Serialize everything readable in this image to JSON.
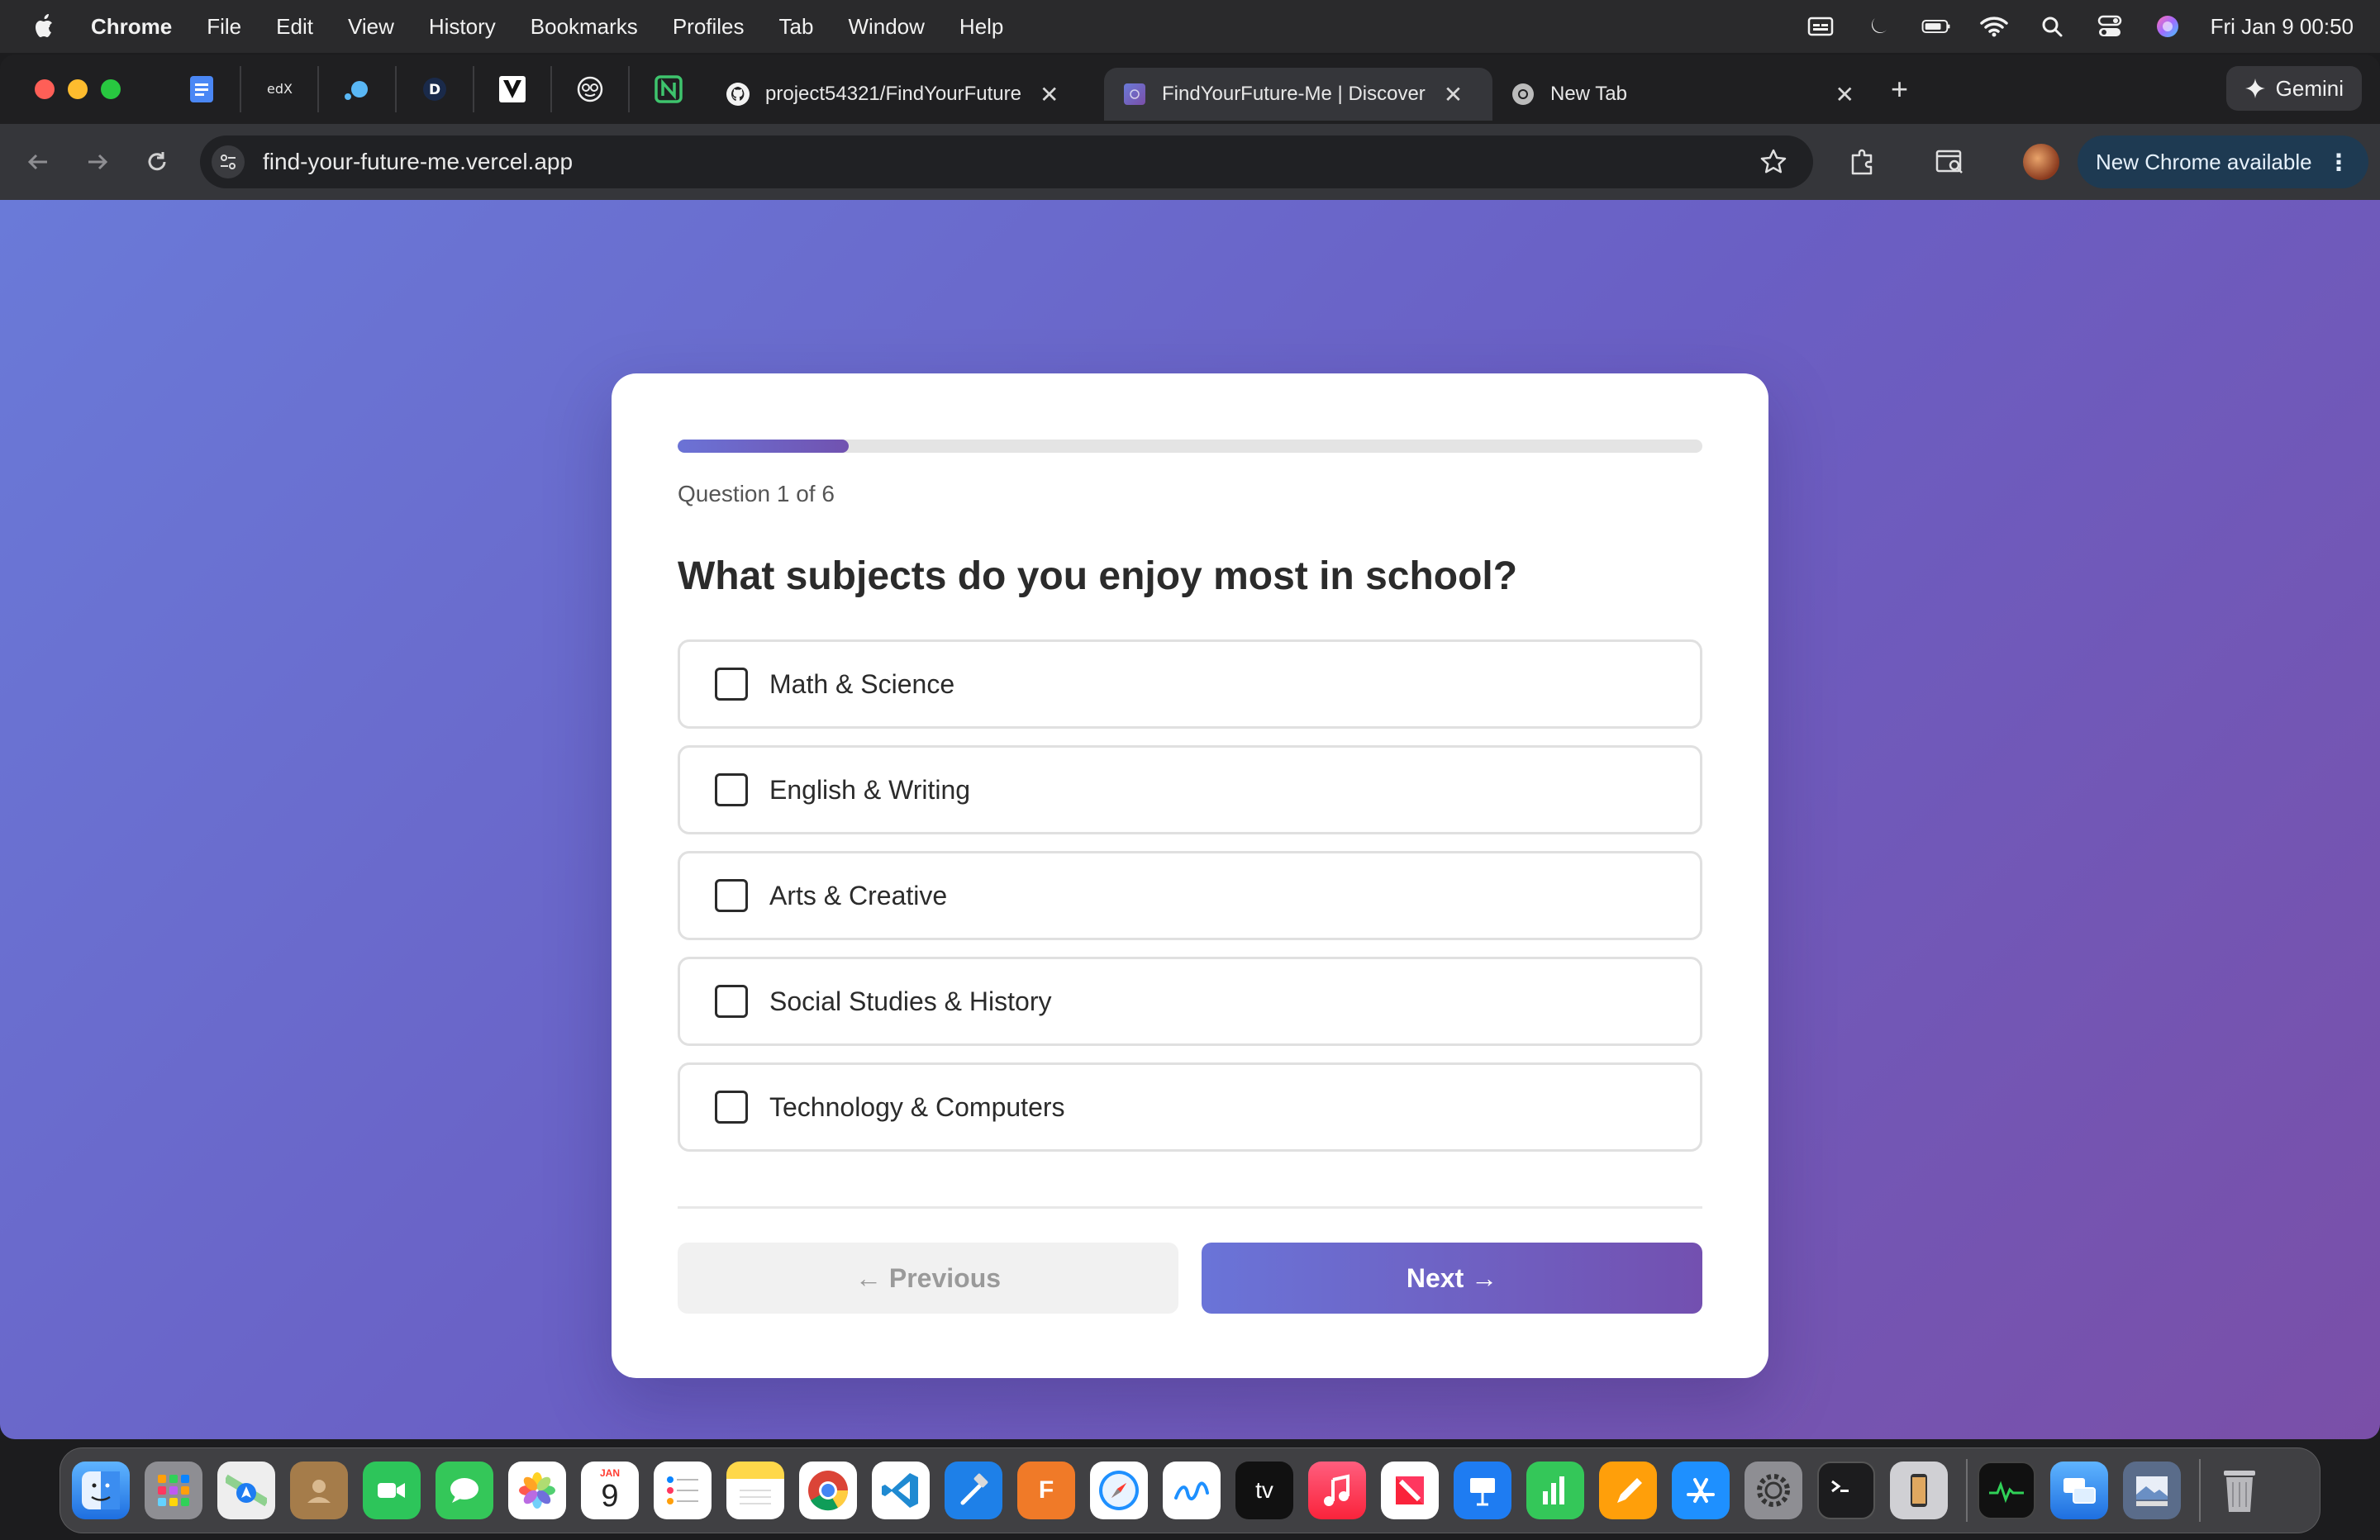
{
  "menubar": {
    "app_name": "Chrome",
    "items": [
      "File",
      "Edit",
      "View",
      "History",
      "Bookmarks",
      "Profiles",
      "Tab",
      "Window",
      "Help"
    ],
    "clock": "Fri Jan 9  00:50"
  },
  "browser": {
    "tabs": [
      {
        "title": "project54321/FindYourFuture",
        "icon": "github-icon"
      },
      {
        "title": "FindYourFuture-Me | Discover",
        "icon": "site-favicon"
      },
      {
        "title": "New Tab",
        "icon": "chrome-icon"
      }
    ],
    "gemini_label": "Gemini",
    "url": "find-your-future-me.vercel.app",
    "update_label": "New Chrome available"
  },
  "quiz": {
    "progress": 0.1667,
    "counter": "Question 1 of 6",
    "question": "What subjects do you enjoy most in school?",
    "options": [
      {
        "label": "Math & Science",
        "checked": false
      },
      {
        "label": "English & Writing",
        "checked": false
      },
      {
        "label": "Arts & Creative",
        "checked": false
      },
      {
        "label": "Social Studies & History",
        "checked": false
      },
      {
        "label": "Technology & Computers",
        "checked": false
      }
    ],
    "prev_label": "← Previous",
    "next_label": "Next →"
  },
  "dock": {
    "calendar_month": "JAN",
    "calendar_day": "9",
    "tv_label": "tv",
    "fusion_label": "F"
  },
  "colors": {
    "accent_start": "#6a74d8",
    "accent_end": "#7350b0",
    "background_start": "#6a7ad8",
    "background_end": "#7a4fa8"
  }
}
